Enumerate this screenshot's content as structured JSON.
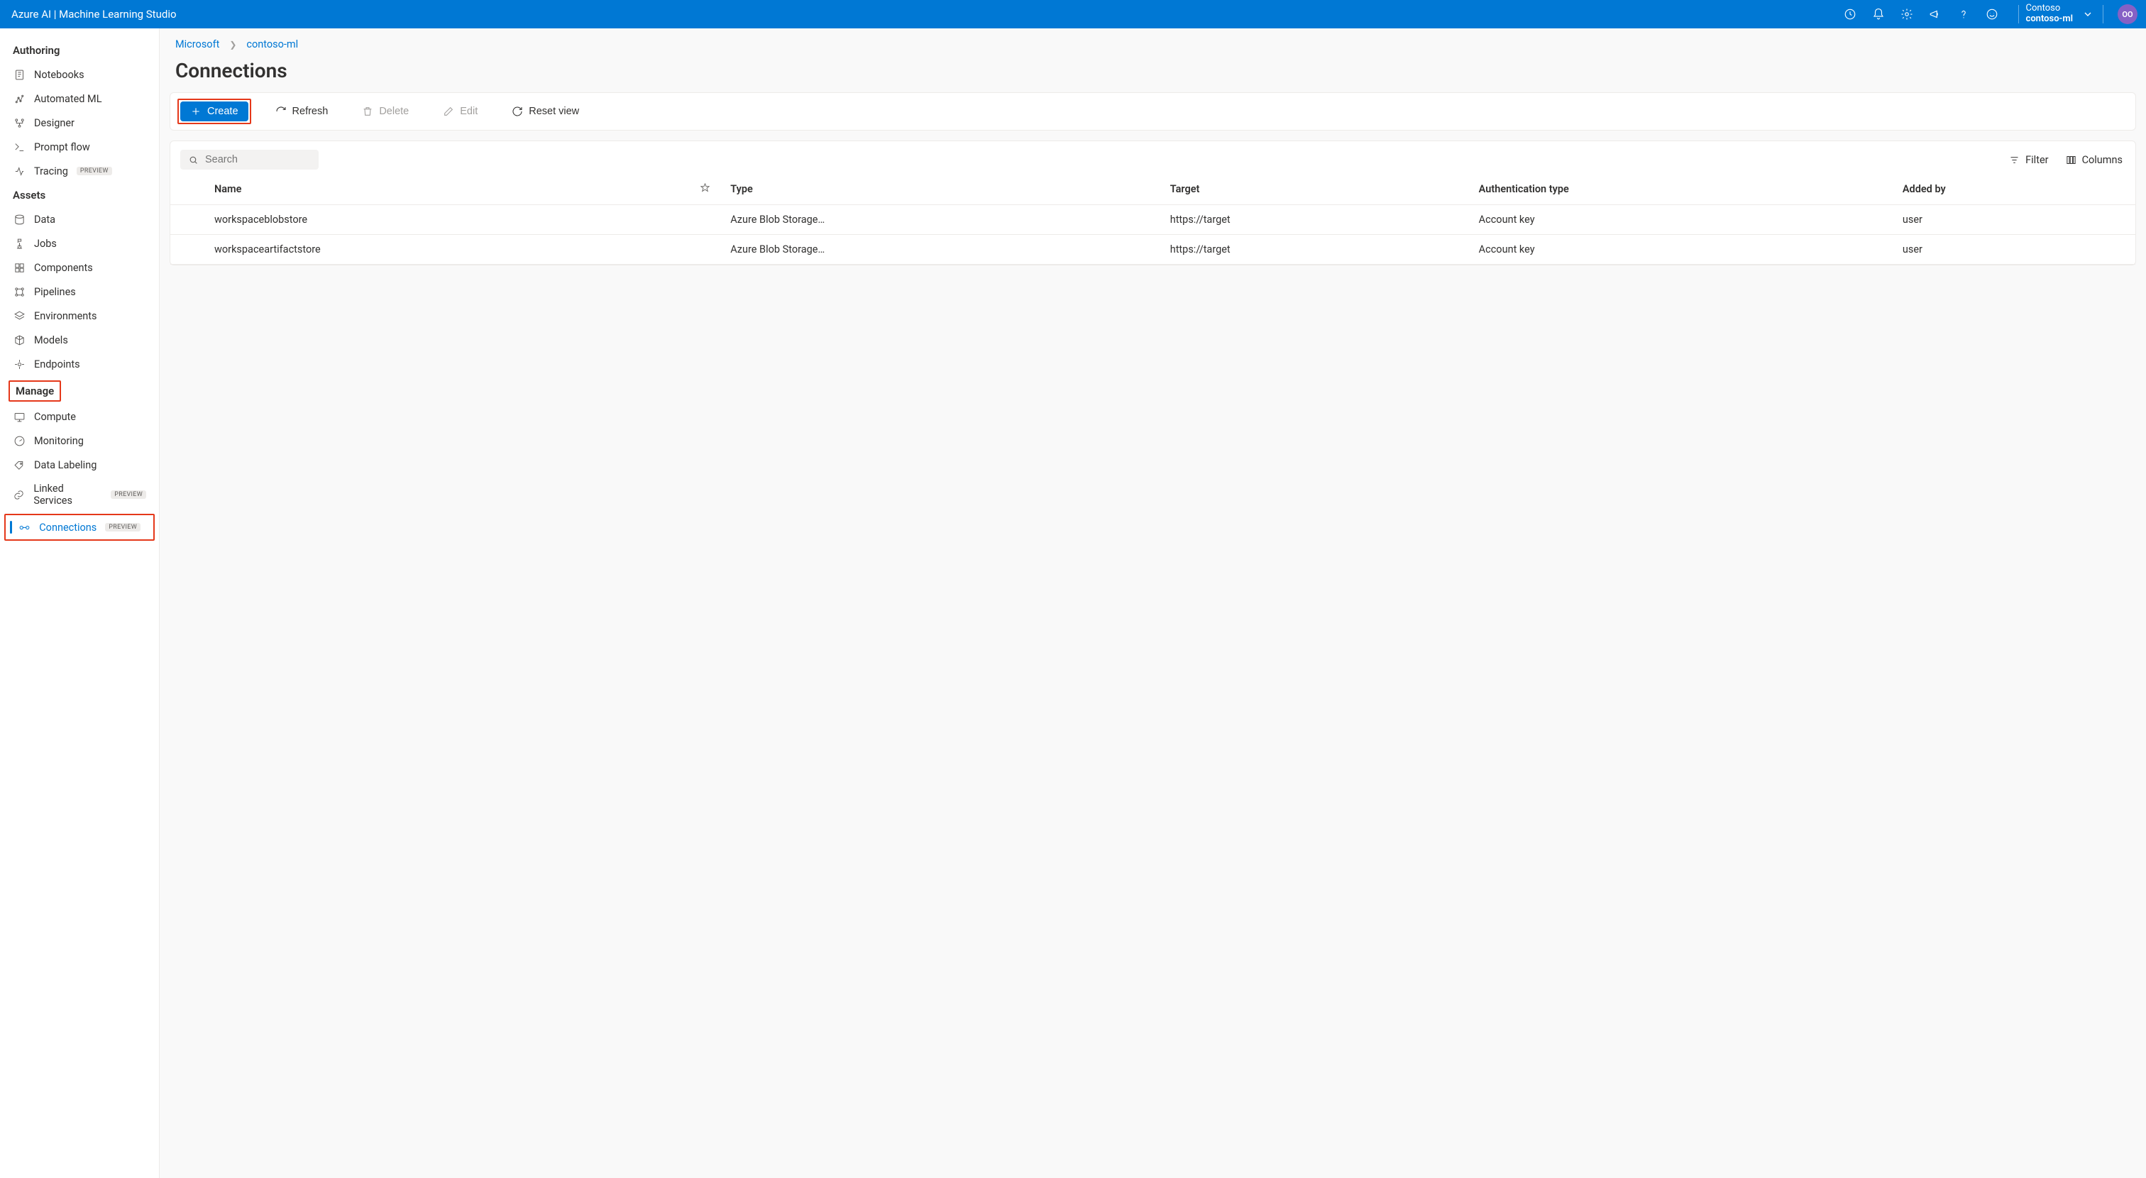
{
  "topbar": {
    "title": "Azure AI | Machine Learning Studio",
    "tenant": "Contoso",
    "workspace": "contoso-ml",
    "avatar_initials": "OO"
  },
  "sidebar": {
    "sections": [
      {
        "label": "Authoring",
        "items": [
          {
            "label": "Notebooks",
            "icon": "notebook"
          },
          {
            "label": "Automated ML",
            "icon": "automl"
          },
          {
            "label": "Designer",
            "icon": "designer"
          },
          {
            "label": "Prompt flow",
            "icon": "prompt"
          },
          {
            "label": "Tracing",
            "icon": "tracing",
            "preview": true
          }
        ]
      },
      {
        "label": "Assets",
        "items": [
          {
            "label": "Data",
            "icon": "data"
          },
          {
            "label": "Jobs",
            "icon": "jobs"
          },
          {
            "label": "Components",
            "icon": "components"
          },
          {
            "label": "Pipelines",
            "icon": "pipelines"
          },
          {
            "label": "Environments",
            "icon": "env"
          },
          {
            "label": "Models",
            "icon": "models"
          },
          {
            "label": "Endpoints",
            "icon": "endpoints"
          }
        ]
      },
      {
        "label": "Manage",
        "highlight": true,
        "items": [
          {
            "label": "Compute",
            "icon": "compute"
          },
          {
            "label": "Monitoring",
            "icon": "monitor"
          },
          {
            "label": "Data Labeling",
            "icon": "labeling"
          },
          {
            "label": "Linked Services",
            "icon": "linked",
            "preview": true
          },
          {
            "label": "Connections",
            "icon": "connections",
            "preview": true,
            "active": true,
            "highlight": true
          }
        ]
      }
    ]
  },
  "breadcrumb": {
    "items": [
      "Microsoft",
      "contoso-ml"
    ]
  },
  "page": {
    "title": "Connections"
  },
  "toolbar": {
    "create_label": "Create",
    "refresh_label": "Refresh",
    "delete_label": "Delete",
    "edit_label": "Edit",
    "reset_label": "Reset view"
  },
  "panel": {
    "search_placeholder": "Search",
    "filter_label": "Filter",
    "columns_label": "Columns"
  },
  "table": {
    "columns": [
      "Name",
      "Type",
      "Target",
      "Authentication type",
      "Added by"
    ],
    "rows": [
      {
        "name": "workspaceblobstore",
        "type": "Azure Blob Storage…",
        "target": "https://target",
        "auth": "Account key",
        "added_by": "user"
      },
      {
        "name": "workspaceartifactstore",
        "type": "Azure Blob Storage…",
        "target": "https://target",
        "auth": "Account key",
        "added_by": "user"
      }
    ]
  },
  "preview_text": "PREVIEW"
}
